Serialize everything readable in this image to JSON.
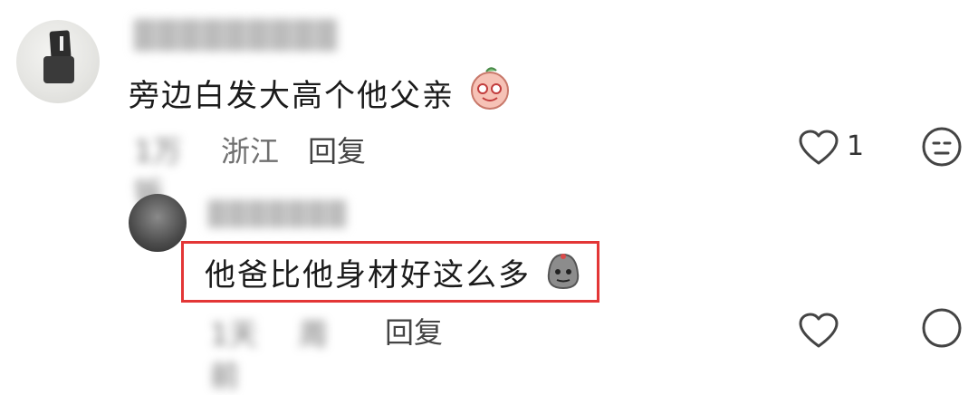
{
  "comment1": {
    "text": "旁边白发大高个他父亲",
    "meta_time": "1万钣",
    "meta_location": "浙江",
    "reply": "回复",
    "likes": "1",
    "username_blurred": "█████████"
  },
  "comment2": {
    "text": "他爸比他身材好这么多",
    "meta_time": "1天 前",
    "meta_location": "周",
    "reply": "回复",
    "username_blurred": "███████"
  },
  "colors": {
    "highlight": "#e33636",
    "meta": "#6f6f6f"
  }
}
